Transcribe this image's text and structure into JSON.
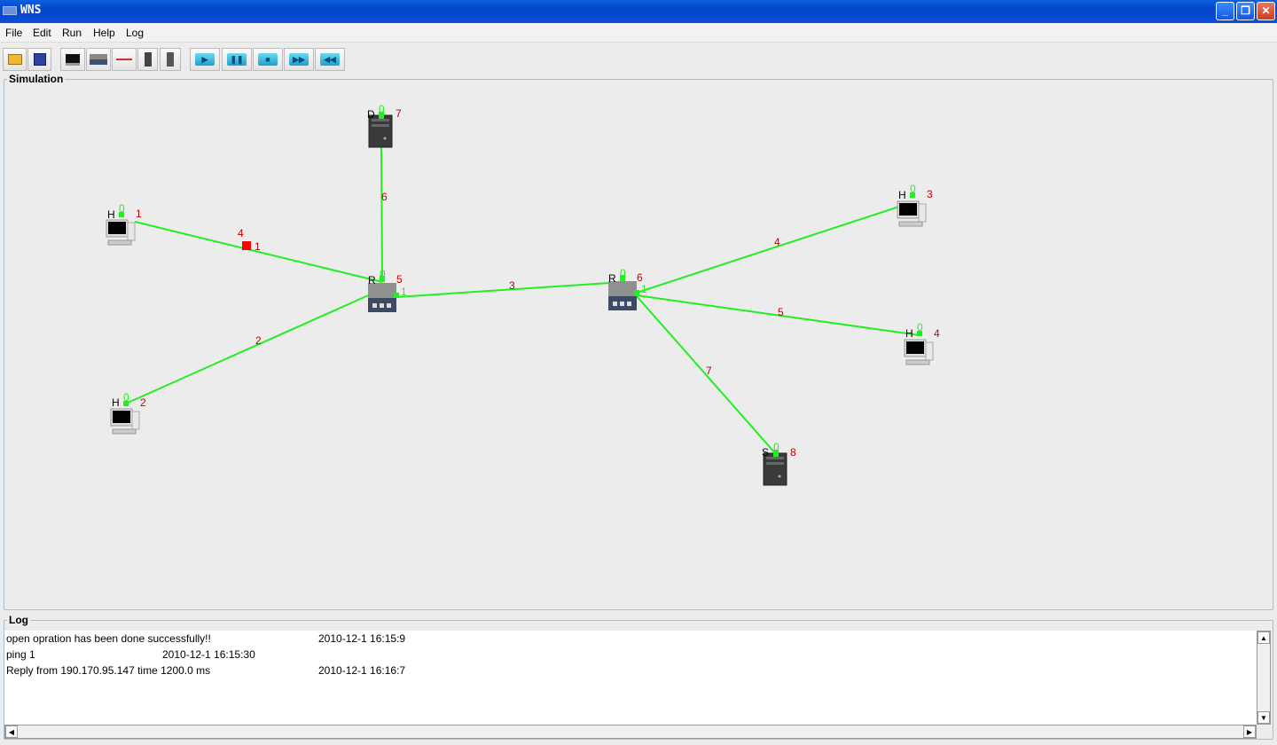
{
  "window": {
    "title": "WNS",
    "minimize": "_",
    "restore": "❐",
    "close": "✕"
  },
  "menu": [
    "File",
    "Edit",
    "Run",
    "Help",
    "Log"
  ],
  "toolbar": [
    {
      "icon": "open-folder-icon"
    },
    {
      "icon": "save-icon"
    },
    {
      "icon": "host-icon"
    },
    {
      "icon": "router-icon"
    },
    {
      "icon": "link-icon"
    },
    {
      "icon": "server-icon"
    },
    {
      "icon": "dns-server-icon"
    },
    {
      "icon": "play-icon",
      "glyph": "▶"
    },
    {
      "icon": "pause-icon",
      "glyph": "❚❚"
    },
    {
      "icon": "stop-icon",
      "glyph": "■"
    },
    {
      "icon": "fast-forward-icon",
      "glyph": "▶▶"
    },
    {
      "icon": "rewind-icon",
      "glyph": "◀◀"
    }
  ],
  "simulation": {
    "title": "Simulation",
    "nodes": [
      {
        "type": "H",
        "id": "1",
        "port": "0"
      },
      {
        "type": "H",
        "id": "2",
        "port": "0"
      },
      {
        "type": "D",
        "id": "7",
        "port": "0"
      },
      {
        "type": "R",
        "id": "5",
        "port": "0",
        "port2": "1"
      },
      {
        "type": "R",
        "id": "6",
        "port": "0",
        "port2": "1"
      },
      {
        "type": "H",
        "id": "3",
        "port": "0"
      },
      {
        "type": "H",
        "id": "4",
        "port": "0"
      },
      {
        "type": "S",
        "id": "8",
        "port": "0"
      }
    ],
    "links": [
      "4",
      "2",
      "6",
      "3",
      "4",
      "5",
      "7"
    ],
    "packet": {
      "label": "4",
      "port": "1",
      "color": "#ff0000"
    },
    "link_color": "#22ee22"
  },
  "log": {
    "title": "Log",
    "entries": [
      {
        "message": "open opration has been done successfully!!",
        "time": "2010-12-1 16:15:9"
      },
      {
        "message": "ping 1",
        "time": "2010-12-1 16:15:30"
      },
      {
        "message": "Reply from 190.170.95.147 time 1200.0 ms",
        "time": "2010-12-1 16:16:7"
      }
    ]
  }
}
